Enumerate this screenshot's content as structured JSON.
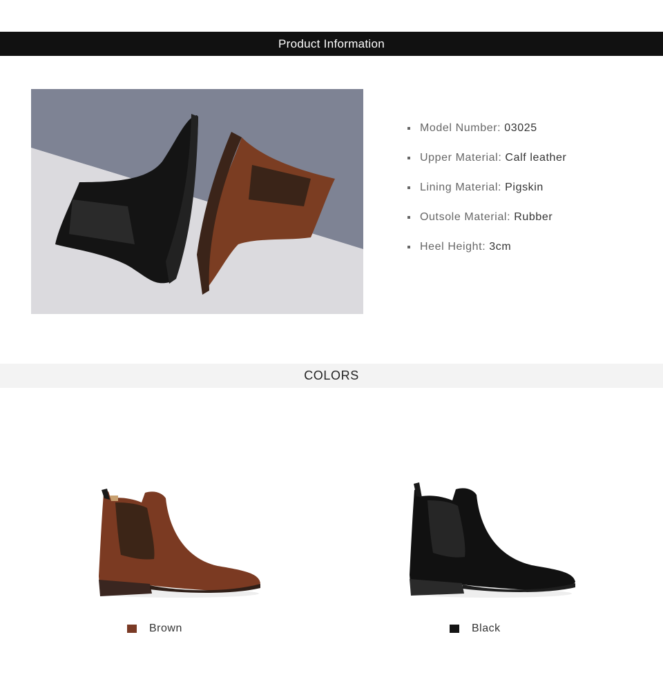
{
  "header": {
    "title": "Product Information"
  },
  "specs": [
    {
      "label": "Model Number:",
      "value": "03025"
    },
    {
      "label": "Upper Material:",
      "value": "Calf leather"
    },
    {
      "label": "Lining Material:",
      "value": "Pigskin"
    },
    {
      "label": "Outsole Material:",
      "value": "Rubber"
    },
    {
      "label": "Heel Height:",
      "value": "3cm"
    }
  ],
  "colors_section": {
    "title": "COLORS",
    "items": [
      {
        "name": "Brown",
        "swatch": "#7a3a25"
      },
      {
        "name": "Black",
        "swatch": "#141414"
      }
    ]
  }
}
